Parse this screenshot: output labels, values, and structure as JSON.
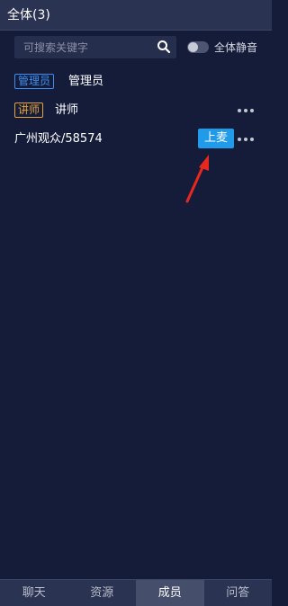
{
  "header": {
    "title": "全体(3)"
  },
  "search": {
    "placeholder": "可搜索关键字"
  },
  "mute_all": {
    "label": "全体静音",
    "on": false
  },
  "members": [
    {
      "badge": "管理员",
      "badge_color": "#3d8ef0",
      "name": "管理员"
    },
    {
      "badge": "讲师",
      "badge_color": "#e6a33a",
      "name": "讲师"
    },
    {
      "name": "广州观众/58574",
      "action_label": "上麦"
    }
  ],
  "tabs": [
    {
      "label": "聊天",
      "active": false
    },
    {
      "label": "资源",
      "active": false
    },
    {
      "label": "成员",
      "active": true
    },
    {
      "label": "问答",
      "active": false
    }
  ],
  "colors": {
    "background": "#141c3a",
    "bar": "#2a3351",
    "accent": "#1f9bea",
    "annotation_arrow": "#e8271e"
  }
}
